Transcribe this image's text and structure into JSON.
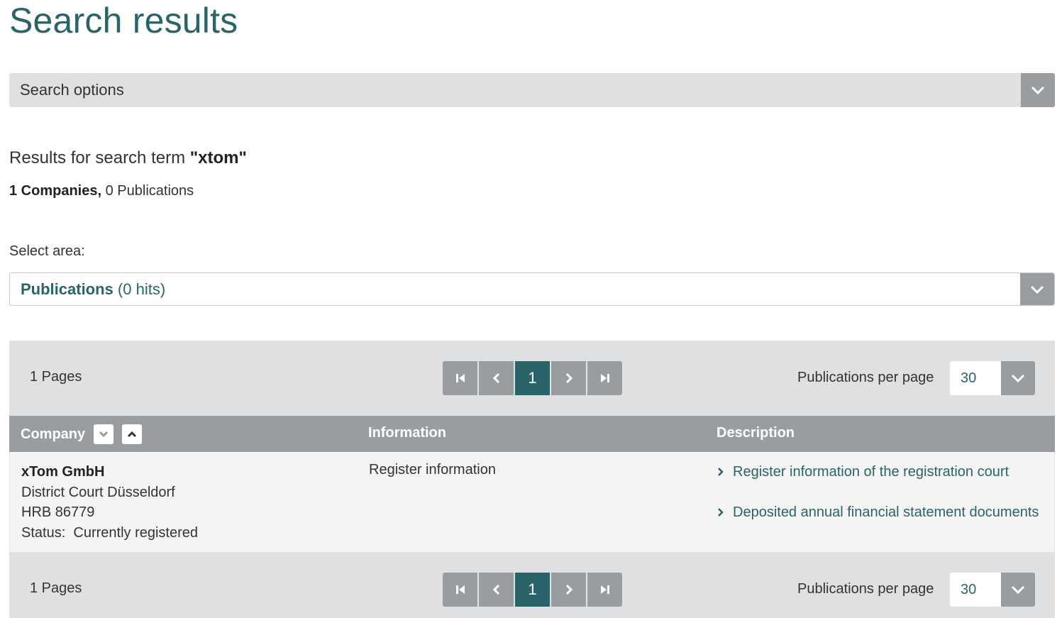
{
  "page": {
    "title": "Search results"
  },
  "search_options": {
    "label": "Search options"
  },
  "results": {
    "prefix": "Results for search term ",
    "term": "\"xtom\"",
    "companies_count": "1 Companies,",
    "publications_count": "0 Publications"
  },
  "area": {
    "label": "Select area:",
    "selected_name": "Publications",
    "selected_hits": "(0 hits)"
  },
  "pagination": {
    "pages_label": "1 Pages",
    "current_page": "1",
    "per_page_label": "Publications per page",
    "per_page_value": "30"
  },
  "table": {
    "headers": {
      "company": "Company",
      "information": "Information",
      "description": "Description"
    },
    "rows": [
      {
        "company_name": "xTom GmbH",
        "court": "District Court Düsseldorf",
        "register_no": "HRB 86779",
        "status_label": "Status:",
        "status_value": "Currently registered",
        "information": "Register information",
        "description_links": [
          "Register information of the registration court",
          "Deposited annual financial statement documents"
        ]
      }
    ]
  },
  "colors": {
    "accent": "#2a6468",
    "bar_gray": "#dfe0e2",
    "button_gray": "#9a9da0"
  }
}
